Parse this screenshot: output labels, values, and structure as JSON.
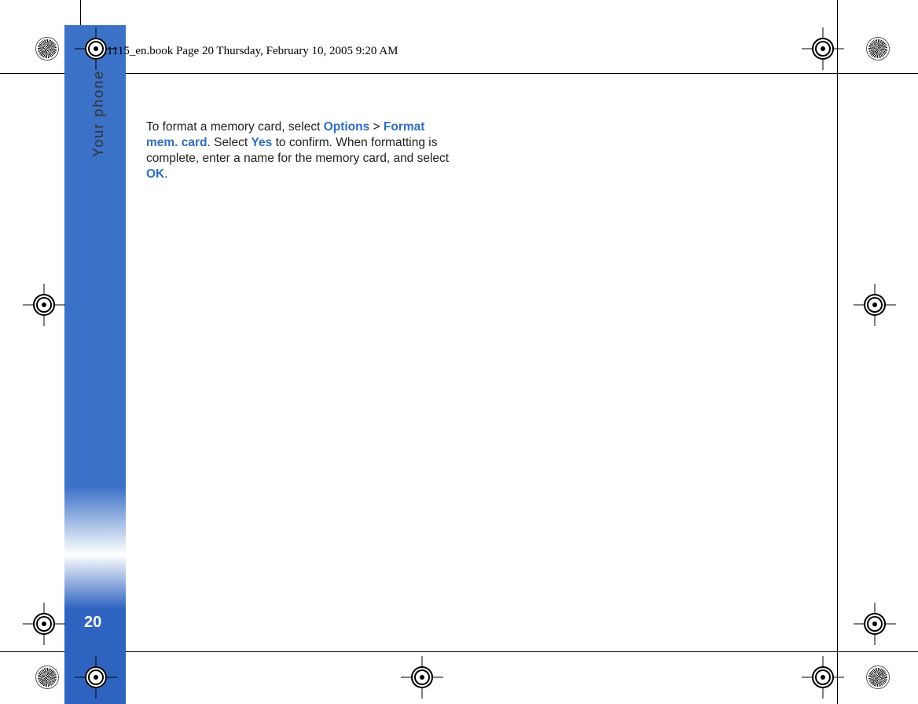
{
  "header": {
    "text": "R1115_en.book  Page 20  Thursday, February 10, 2005  9:20 AM"
  },
  "sidebar": {
    "section_label": "Your phone",
    "page_number": "20"
  },
  "body": {
    "t1": "To format a memory card, select ",
    "hl1": "Options",
    "sep1": " > ",
    "hl2": "Format mem. card",
    "t2": ". Select ",
    "hl3": "Yes",
    "t3": " to confirm. When formatting is complete, enter a name for the memory card, and select ",
    "hl4": "OK",
    "t4": "."
  }
}
